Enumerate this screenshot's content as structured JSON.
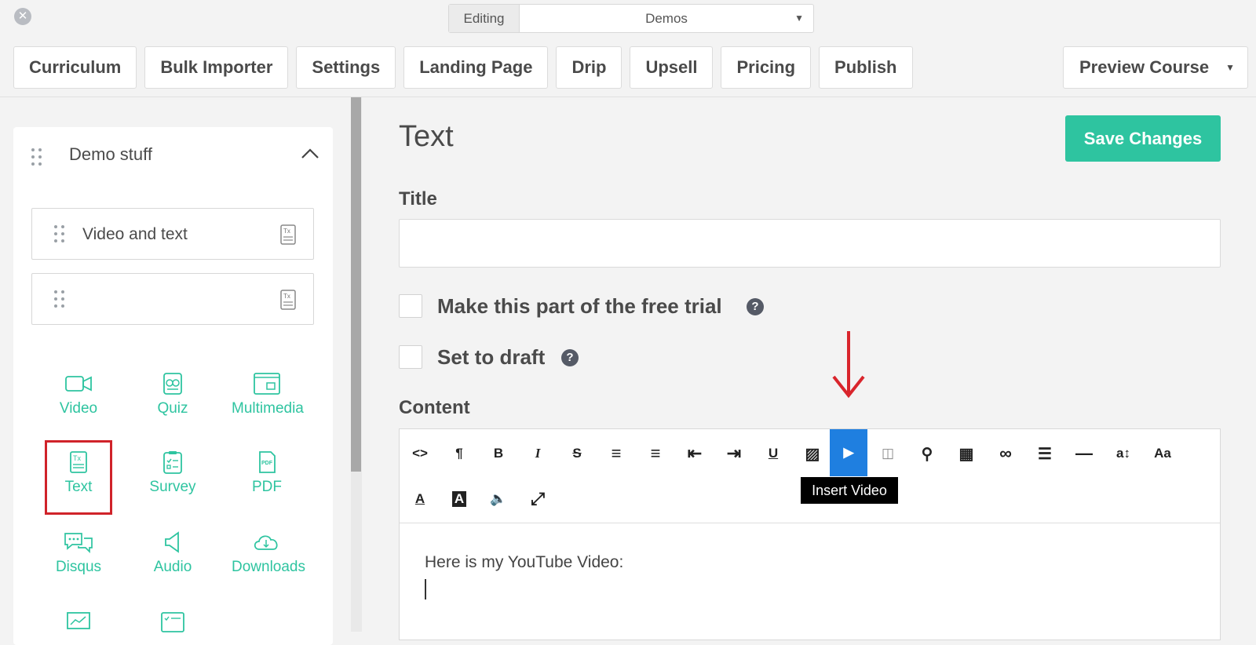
{
  "topbar": {
    "close_symbol": "✕",
    "editing_label": "Editing",
    "editing_value": "Demos",
    "editing_caret": "▼",
    "tabs": [
      "Curriculum",
      "Bulk Importer",
      "Settings",
      "Landing Page",
      "Drip",
      "Upsell",
      "Pricing",
      "Publish"
    ],
    "preview_label": "Preview Course",
    "preview_caret": "▼"
  },
  "sidebar": {
    "section_title": "Demo stuff",
    "lessons": [
      {
        "label": "Video and text",
        "icon": "text-lesson-icon"
      },
      {
        "label": "",
        "icon": "text-lesson-icon"
      }
    ],
    "types": [
      {
        "label": "Video",
        "icon": "video-camera-icon"
      },
      {
        "label": "Quiz",
        "icon": "quiz-icon"
      },
      {
        "label": "Multimedia",
        "icon": "multimedia-icon"
      },
      {
        "label": "Text",
        "icon": "text-doc-icon"
      },
      {
        "label": "Survey",
        "icon": "survey-clipboard-icon"
      },
      {
        "label": "PDF",
        "icon": "pdf-icon"
      },
      {
        "label": "Disqus",
        "icon": "chat-bubbles-icon"
      },
      {
        "label": "Audio",
        "icon": "speaker-icon"
      },
      {
        "label": "Downloads",
        "icon": "cloud-download-icon"
      },
      {
        "label": "",
        "icon": "presentation-chart-icon"
      },
      {
        "label": "",
        "icon": "checklist-icon"
      }
    ],
    "accent_color": "#2ec4a0",
    "highlight_color": "#d0232a"
  },
  "main": {
    "heading": "Text",
    "save_label": "Save Changes",
    "title_label": "Title",
    "title_value": "",
    "free_trial_label": "Make this part of the free trial",
    "draft_label": "Set to draft",
    "help_symbol": "?",
    "content_label": "Content"
  },
  "editor": {
    "toolbar_row1": [
      {
        "name": "html-code-icon",
        "glyph": "<>"
      },
      {
        "name": "paragraph-icon",
        "glyph": "¶"
      },
      {
        "name": "bold-icon",
        "glyph": "B"
      },
      {
        "name": "italic-icon",
        "glyph": "I"
      },
      {
        "name": "strikethrough-icon",
        "glyph": "S"
      },
      {
        "name": "unordered-list-icon",
        "glyph": "≡"
      },
      {
        "name": "ordered-list-icon",
        "glyph": "≡"
      },
      {
        "name": "outdent-icon",
        "glyph": "⇤"
      },
      {
        "name": "indent-icon",
        "glyph": "⇥"
      },
      {
        "name": "underline-icon",
        "glyph": "U"
      },
      {
        "name": "insert-image-icon",
        "glyph": "▨"
      },
      {
        "name": "insert-video-icon",
        "glyph": "▶"
      },
      {
        "name": "video-camera-icon",
        "glyph": "◫"
      },
      {
        "name": "attachment-icon",
        "glyph": "⚲"
      },
      {
        "name": "table-icon",
        "glyph": "▦"
      },
      {
        "name": "link-icon",
        "glyph": "∞"
      },
      {
        "name": "align-icon",
        "glyph": "☰"
      },
      {
        "name": "horizontal-rule-icon",
        "glyph": "—"
      },
      {
        "name": "font-size-icon",
        "glyph": "a↕"
      },
      {
        "name": "font-family-icon",
        "glyph": "Aa"
      }
    ],
    "toolbar_row2": [
      {
        "name": "text-color-icon",
        "glyph": "A"
      },
      {
        "name": "background-color-icon",
        "glyph": "A"
      },
      {
        "name": "audio-icon",
        "glyph": "🔈"
      },
      {
        "name": "fullscreen-icon",
        "glyph": "⤢"
      }
    ],
    "active_tool": "insert-video-icon",
    "tooltip": "Insert Video",
    "body_text": "Here is my YouTube Video:",
    "active_color": "#1f7fe0"
  }
}
